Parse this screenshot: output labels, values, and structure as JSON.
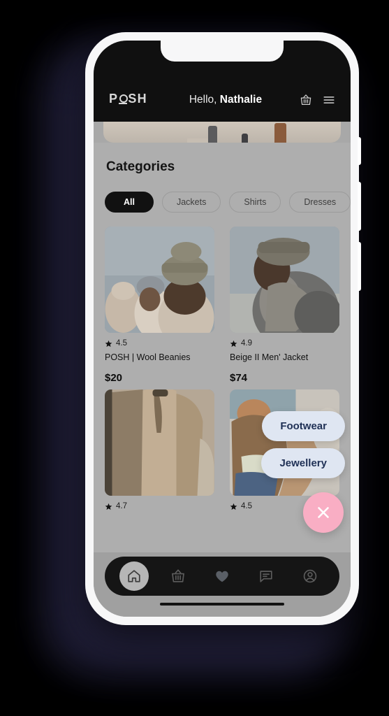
{
  "background": {
    "page_color": "#000000",
    "glow_color": "#1b1a30"
  },
  "device": {
    "frame_color": "#f7f7f8",
    "screen_bg": "#aeaeae"
  },
  "header": {
    "logo_prefix": "P",
    "logo_suffix": "SH",
    "logo_icon": "o-underline-mark",
    "greeting_prefix": "Hello, ",
    "greeting_name": "Nathalie",
    "cart_icon": "basket-icon",
    "menu_icon": "hamburger-menu-icon",
    "bg_color": "#101010"
  },
  "main": {
    "section_title": "Categories",
    "chips": [
      {
        "label": "All",
        "active": true
      },
      {
        "label": "Jackets",
        "active": false
      },
      {
        "label": "Shirts",
        "active": false
      },
      {
        "label": "Dresses",
        "active": false
      }
    ],
    "products": [
      {
        "name": "POSH | Wool Beanies",
        "rating": "4.5",
        "price": "$20",
        "image_alt": "three-people-wearing-beanies"
      },
      {
        "name": "Beige II Men' Jacket",
        "rating": "4.9",
        "price": "$74",
        "image_alt": "man-in-grey-hooded-jacket"
      },
      {
        "name": "",
        "rating": "4.7",
        "price": "",
        "image_alt": "beige-hooded-jacket-product"
      },
      {
        "name": "",
        "rating": "4.5",
        "price": "",
        "image_alt": "person-in-tan-jacket-and-jeans"
      }
    ],
    "star_icon": "star-icon"
  },
  "fab": {
    "pills": [
      {
        "label": "Footwear"
      },
      {
        "label": "Jewellery"
      }
    ],
    "close_icon": "close-x-icon",
    "pill_bg": "#dfe6f2",
    "pill_text_color": "#1f3055",
    "close_bg": "#f9aec4"
  },
  "bottom_nav": {
    "items": [
      {
        "icon": "home-icon",
        "active": true
      },
      {
        "icon": "basket-icon",
        "active": false
      },
      {
        "icon": "heart-icon",
        "active": false
      },
      {
        "icon": "chat-icon",
        "active": false
      },
      {
        "icon": "profile-icon",
        "active": false
      }
    ],
    "bg_color": "#151515"
  }
}
